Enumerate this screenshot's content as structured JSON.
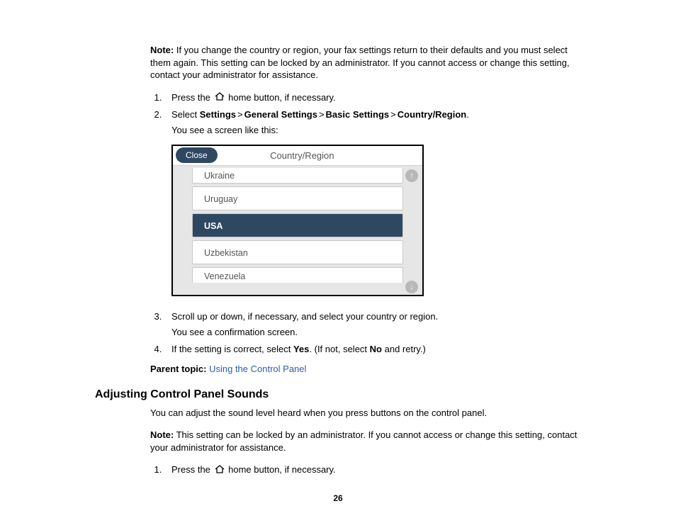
{
  "note1_label": "Note:",
  "note1_text": " If you change the country or region, your fax settings return to their defaults and you must select them again. This setting can be locked by an administrator. If you cannot access or change this setting, contact your administrator for assistance.",
  "steps_a": {
    "s1_a": "Press the ",
    "s1_b": " home button, if necessary.",
    "s2_a": "Select ",
    "s2_b": "Settings",
    "s2_c": "General Settings",
    "s2_d": "Basic Settings",
    "s2_e": "Country/Region",
    "s2_sep": ">",
    "s2_end": ".",
    "s2_sub": "You see a screen like this:"
  },
  "device": {
    "close": "Close",
    "title": "Country/Region",
    "rows": [
      "Ukraine",
      "Uruguay",
      "USA",
      "Uzbekistan",
      "Venezuela"
    ],
    "scroll_up": "↑",
    "scroll_down": "↓"
  },
  "steps_b": {
    "s3": "Scroll up or down, if necessary, and select your country or region.",
    "s3_sub": "You see a confirmation screen.",
    "s4_a": "If the setting is correct, select ",
    "s4_b": "Yes",
    "s4_c": ". (If not, select ",
    "s4_d": "No",
    "s4_e": " and retry.)"
  },
  "parent_label": "Parent topic:",
  "parent_link": "Using the Control Panel",
  "section2_heading": "Adjusting Control Panel Sounds",
  "section2_intro": "You can adjust the sound level heard when you press buttons on the control panel.",
  "note2_label": "Note:",
  "note2_text": " This setting can be locked by an administrator. If you cannot access or change this setting, contact your administrator for assistance.",
  "steps_c": {
    "s1_a": "Press the ",
    "s1_b": " home button, if necessary."
  },
  "page_number": "26"
}
